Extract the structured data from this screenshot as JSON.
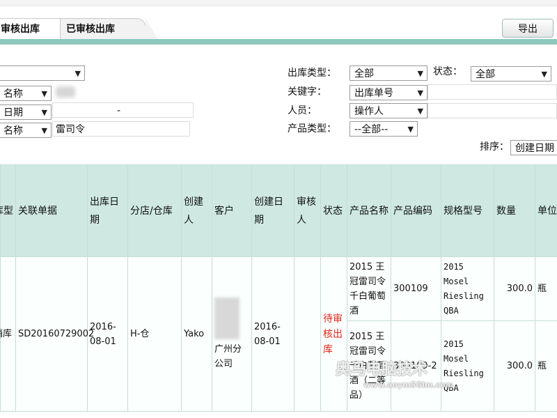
{
  "tabs": [
    {
      "label": "审核出库"
    },
    {
      "label": "已审核出库"
    }
  ],
  "toolbar": {
    "export_label": "导出"
  },
  "filters": {
    "left": [
      {
        "type": "select",
        "value": ""
      },
      {
        "type": "select",
        "value": "名称",
        "input": ""
      },
      {
        "type": "select",
        "value": "日期",
        "input": "-"
      },
      {
        "type": "select",
        "value": "名称",
        "input": "雷司令"
      }
    ],
    "outbound_type_label": "出库类型：",
    "outbound_type_value": "全部",
    "status_label": "状态：",
    "status_value": "全部",
    "keyword_label": "关键字：",
    "keyword_value": "出库单号",
    "person_label": "人员：",
    "person_value": "操作人",
    "product_type_label": "产品类型：",
    "product_type_value": "--全部--",
    "sort_label": "排序：",
    "sort_value": "创建日期"
  },
  "table": {
    "headers": [
      "库型",
      "关联单据",
      "出库日期",
      "分店/仓库",
      "创建人",
      "客户",
      "创建日期",
      "审核人",
      "状态",
      "产品名称",
      "产品编码",
      "规格型号",
      "数量",
      "单位"
    ],
    "row": {
      "type": "销库",
      "related_doc": "SD20160729002",
      "outbound_date": "2016-08-01",
      "store": "H-仓",
      "creator": "Yako",
      "customer": "广州分公司",
      "created_date": "2016-08-01",
      "reviewer": "",
      "status": "待审核出库",
      "items": [
        {
          "name": "2015 王冠雷司令千白葡萄酒",
          "code": "300109",
          "spec": "2015 Mosel Riesling QBA",
          "qty": "300.0",
          "unit": "瓶"
        },
        {
          "name": "2015 王冠雷司令千白葡萄酒（二等品）",
          "code": "300109-2",
          "spec": "2015 Mosel Riesling QBA",
          "qty": "300.0",
          "unit": "瓶"
        }
      ]
    }
  },
  "watermark": {
    "text": "奥马电脑技术",
    "sub": "www.aoym5Glm.com"
  },
  "colors": {
    "accent": "#8fc9bd",
    "header_bg": "#cfe9e2",
    "status_red": "#e0261b"
  }
}
